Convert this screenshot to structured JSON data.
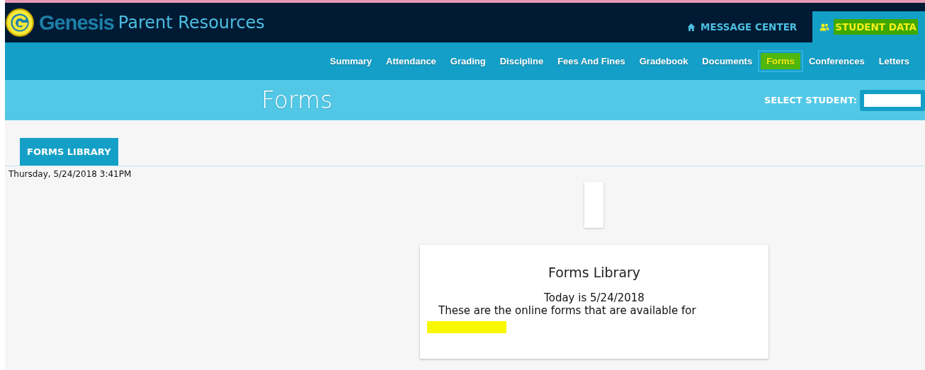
{
  "header": {
    "logo_word": "Genesis",
    "title": "Parent Resources",
    "links": [
      {
        "label": "MESSAGE CENTER",
        "kind": "home",
        "selected": false
      },
      {
        "label": "STUDENT DATA",
        "kind": "people",
        "selected": true
      }
    ]
  },
  "nav": [
    {
      "label": "Summary",
      "selected": false
    },
    {
      "label": "Attendance",
      "selected": false
    },
    {
      "label": "Grading",
      "selected": false
    },
    {
      "label": "Discipline",
      "selected": false
    },
    {
      "label": "Fees And Fines",
      "selected": false
    },
    {
      "label": "Gradebook",
      "selected": false
    },
    {
      "label": "Documents",
      "selected": false
    },
    {
      "label": "Forms",
      "selected": true
    },
    {
      "label": "Conferences",
      "selected": false
    },
    {
      "label": "Letters",
      "selected": false
    }
  ],
  "page_title": "Forms",
  "select_student_label": "SELECT STUDENT:",
  "tabs": [
    {
      "label": "FORMS LIBRARY",
      "selected": true
    }
  ],
  "timestamp": "Thursday, 5/24/2018 3:41PM",
  "card": {
    "title": "Forms Library",
    "today": "Today is 5/24/2018",
    "description": "These are the online forms that are available for"
  }
}
